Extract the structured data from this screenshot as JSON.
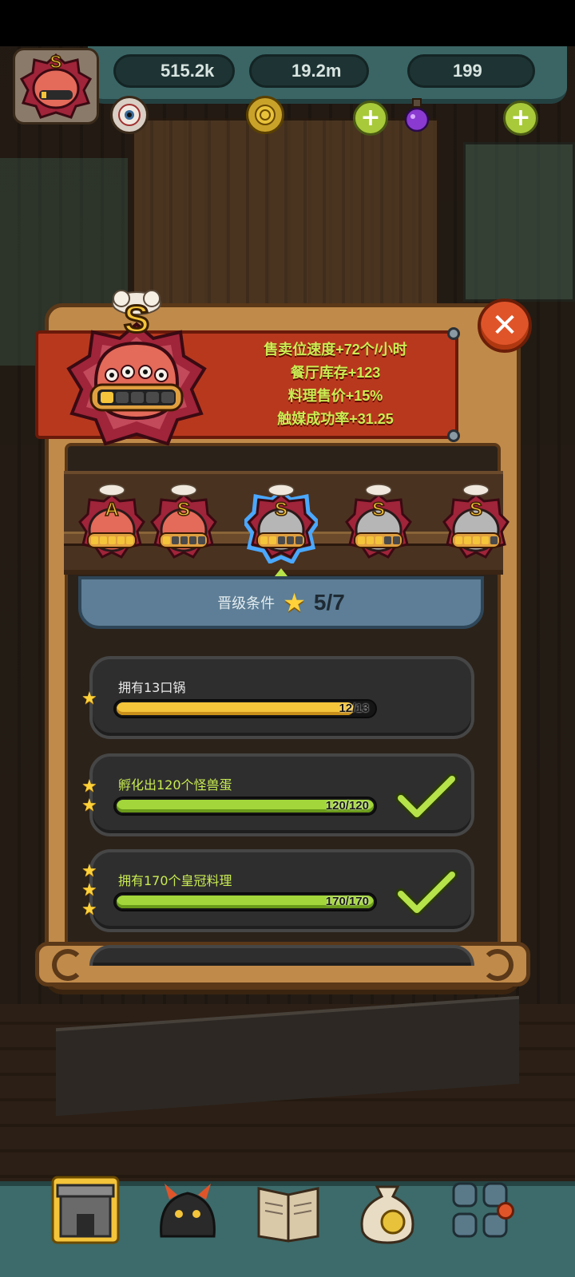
{
  "resources": [
    {
      "icon": "eyeball-icon",
      "value": "515.2k"
    },
    {
      "icon": "coin-icon",
      "value": "19.2m"
    },
    {
      "icon": "potion-icon",
      "value": "199"
    }
  ],
  "current_rank": {
    "grade": "S",
    "filled_slots": 1,
    "total_slots": 5
  },
  "bonuses": [
    "售卖位速度+72个/小时",
    "餐厅库存+123",
    "料理售价+15%",
    "触媒成功率+31.25"
  ],
  "rank_carousel": [
    {
      "grade": "A",
      "filled": 5,
      "color": "#e46a5a",
      "selected": false
    },
    {
      "grade": "S",
      "filled": 1,
      "color": "#e46a5a",
      "selected": false
    },
    {
      "grade": "S",
      "filled": 2,
      "color": "#b6b6b6",
      "selected": true
    },
    {
      "grade": "S",
      "filled": 3,
      "color": "#b6b6b6",
      "selected": false
    },
    {
      "grade": "S",
      "filled": 4,
      "color": "#b6b6b6",
      "selected": false
    }
  ],
  "upgrade": {
    "label": "晋级条件",
    "count": "5/7"
  },
  "requirements": [
    {
      "title": "拥有13口锅",
      "progress_text": "12/13",
      "progress": 0.923,
      "stars": 1,
      "done": false
    },
    {
      "title": "孵化出120个怪兽蛋",
      "progress_text": "120/120",
      "progress": 1.0,
      "stars": 2,
      "done": true
    },
    {
      "title": "拥有170个皇冠料理",
      "progress_text": "170/170",
      "progress": 1.0,
      "stars": 3,
      "done": true
    }
  ],
  "nav": [
    {
      "icon": "restaurant-icon",
      "active": true
    },
    {
      "icon": "monster-icon",
      "active": false
    },
    {
      "icon": "recipe-book-icon",
      "active": false
    },
    {
      "icon": "coin-bag-icon",
      "active": false
    },
    {
      "icon": "grid-menu-icon",
      "active": false
    }
  ]
}
